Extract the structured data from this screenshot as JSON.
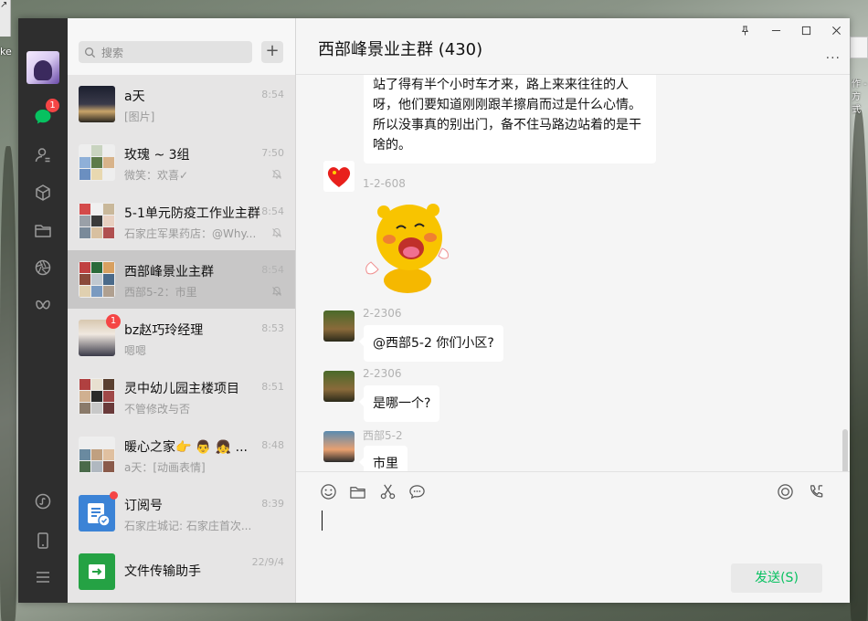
{
  "desktop": {
    "left_label": "ke",
    "right_label": "作 - 方式"
  },
  "nav": {
    "chat_badge": "1"
  },
  "list": {
    "search_placeholder": "搜索",
    "add_label": "+",
    "items": [
      {
        "name": "a天",
        "preview": "[图片]",
        "time": "8:54",
        "muted": false
      },
      {
        "name": "玫瑰 ~ 3组",
        "preview": "微笑：欢喜✓",
        "time": "7:50",
        "muted": true
      },
      {
        "name": "5-1单元防疫工作业主群",
        "preview": "石家庄军果药店：@Why...",
        "time": "8:54",
        "muted": true
      },
      {
        "name": "西部峰景业主群",
        "preview": "西部5-2：市里",
        "time": "8:54",
        "muted": true,
        "active": true
      },
      {
        "name": "bz赵巧玲经理",
        "preview": "嗯嗯",
        "time": "8:53",
        "muted": false,
        "badge": "1"
      },
      {
        "name": "灵中幼儿园主楼项目",
        "preview": "不管修改与否",
        "time": "8:51",
        "muted": false
      },
      {
        "name": "暖心之家👉 👨 👧 ...",
        "preview": "a天：[动画表情]",
        "time": "8:48",
        "muted": false
      },
      {
        "name": "订阅号",
        "preview": "石家庄城记: 石家庄首次...",
        "time": "8:39",
        "muted": false,
        "dot": true
      },
      {
        "name": "文件传输助手",
        "preview": "",
        "time": "22/9/4",
        "muted": false
      }
    ]
  },
  "chat": {
    "title": "西部峰景业主群 (430)",
    "more_label": "···",
    "messages": [
      {
        "nick": "",
        "text": "站了得有半个小时车才来，路上来来往往的人呀，他们要知道刚刚跟羊擦肩而过是什么心情。所以没事真的别出门，备不住马路边站着的是干啥的。"
      },
      {
        "nick": "1-2-608",
        "text": "[动画表情]"
      },
      {
        "nick": "2-2306",
        "text": "@西部5-2 你们小区?"
      },
      {
        "nick": "2-2306",
        "text": "是哪一个?"
      },
      {
        "nick": "西部5-2",
        "text": "市里"
      }
    ],
    "send_label": "发送(S)"
  }
}
